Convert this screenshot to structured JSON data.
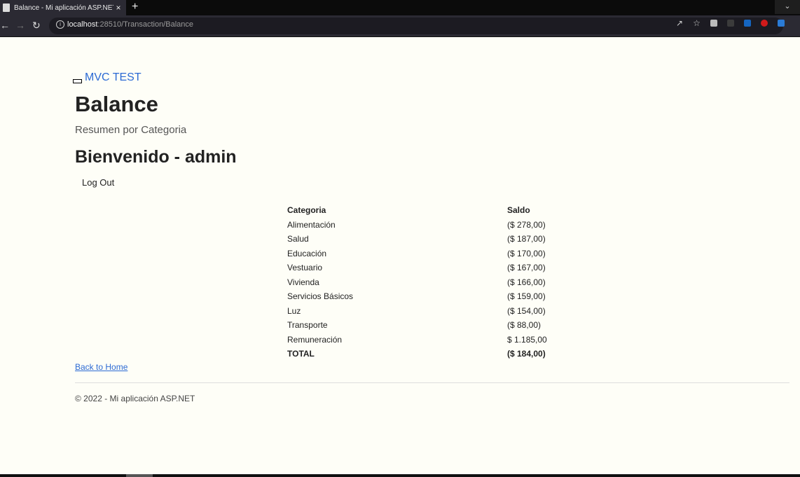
{
  "browser": {
    "tab_title": "Balance - Mi aplicación ASP.NET",
    "tab_close": "×",
    "new_tab": "+",
    "url_host": "localhost",
    "url_rest": ":28510/Transaction/Balance"
  },
  "brand": "MVC TEST",
  "page_title": "Balance",
  "subtitle": "Resumen por Categoria",
  "welcome": "Bienvenido - admin",
  "logout": "Log Out",
  "table": {
    "headers": [
      "Categoria",
      "Saldo"
    ],
    "rows": [
      [
        "Alimentación",
        "($ 278,00)"
      ],
      [
        "Salud",
        "($ 187,00)"
      ],
      [
        "Educación",
        "($ 170,00)"
      ],
      [
        "Vestuario",
        "($ 167,00)"
      ],
      [
        "Vivienda",
        "($ 166,00)"
      ],
      [
        "Servicios Básicos",
        "($ 159,00)"
      ],
      [
        "Luz",
        "($ 154,00)"
      ],
      [
        "Transporte",
        "($ 88,00)"
      ],
      [
        "Remuneración",
        "$ 1.185,00"
      ]
    ],
    "total": [
      "TOTAL",
      "($ 184,00)"
    ]
  },
  "back_link": "Back to Home",
  "footer": "© 2022 - Mi aplicación ASP.NET"
}
